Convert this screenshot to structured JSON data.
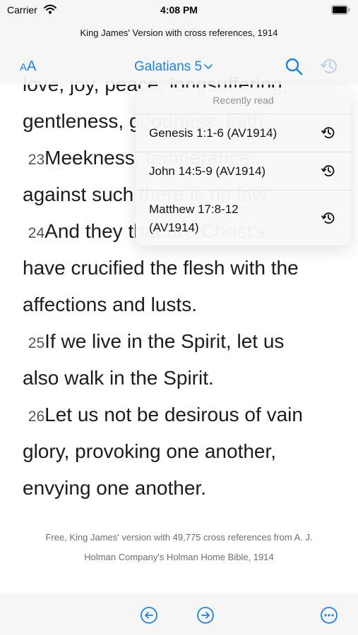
{
  "status": {
    "carrier": "Carrier",
    "time": "4:08 PM"
  },
  "header": {
    "subtitle": "King James' Version with cross references, 1914"
  },
  "nav": {
    "font_size_label_small": "A",
    "font_size_label_large": "A",
    "book": "Galatians 5"
  },
  "content": {
    "lines": [
      {
        "num": "",
        "text": "love, joy, peace, longsuffering,"
      },
      {
        "num": "",
        "text": "gentleness, goodness, faith,"
      },
      {
        "num": "23",
        "text": "Meekness, temperance:"
      },
      {
        "num": "",
        "text": "against such there is no law."
      },
      {
        "num": "24",
        "text": "And they that are Christ's"
      },
      {
        "num": "",
        "text": "have crucified the flesh with the"
      },
      {
        "num": "",
        "text": "affections and lusts."
      },
      {
        "num": "25",
        "text": "If we live in the Spirit, let us"
      },
      {
        "num": "",
        "text": "also walk in the Spirit."
      },
      {
        "num": "26",
        "text": "Let us not be desirous of vain"
      },
      {
        "num": "",
        "text": "glory, provoking one another,"
      },
      {
        "num": "",
        "text": "envying one another."
      }
    ]
  },
  "popover": {
    "title": "Recently read",
    "items": [
      {
        "line1": "Genesis 1:1-6 (AV1914)",
        "line2": ""
      },
      {
        "line1": "John 14:5-9 (AV1914)",
        "line2": ""
      },
      {
        "line1": "Matthew 17:8-12",
        "line2": "(AV1914)"
      }
    ]
  },
  "footer": {
    "line1": "Free, King James' version with 49,775 cross references from A. J.",
    "line2": "Holman Company's Holman Home Bible, 1914"
  },
  "colors": {
    "accent": "#1a82e2",
    "bar_background": "#f6f6f6",
    "text": "#1c1c1e"
  },
  "icons": [
    "wifi-icon",
    "battery-icon",
    "chevron-down-icon",
    "search-icon",
    "history-icon",
    "clock-icon",
    "arrow-left-circle-icon",
    "arrow-right-circle-icon",
    "more-circle-icon"
  ]
}
